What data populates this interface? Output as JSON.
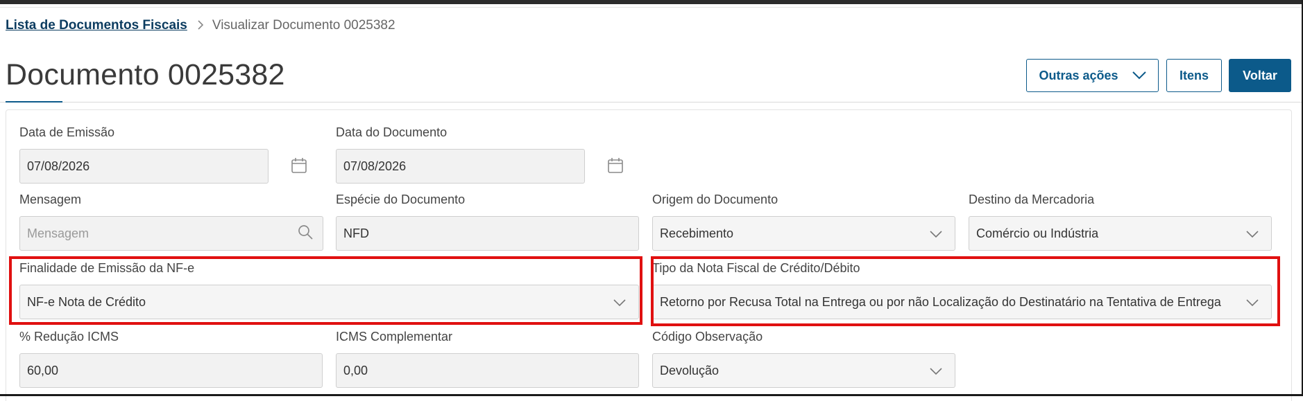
{
  "breadcrumb": {
    "parent": "Lista de Documentos Fiscais",
    "separator": ">",
    "current": "Visualizar Documento 0025382"
  },
  "page_title": "Documento 0025382",
  "actions": {
    "more_actions": "Outras ações",
    "items": "Itens",
    "back": "Voltar"
  },
  "fields": {
    "data_emissao": {
      "label": "Data de Emissão",
      "value": "07/08/2026"
    },
    "data_documento": {
      "label": "Data do Documento",
      "value": "07/08/2026"
    },
    "mensagem": {
      "label": "Mensagem",
      "placeholder": "Mensagem"
    },
    "especie": {
      "label": "Espécie do Documento",
      "value": "NFD"
    },
    "origem": {
      "label": "Origem do Documento",
      "value": "Recebimento"
    },
    "destino": {
      "label": "Destino da Mercadoria",
      "value": "Comércio ou Indústria"
    },
    "finalidade": {
      "label": "Finalidade de Emissão da NF-e",
      "value": "NF-e Nota de Crédito"
    },
    "tipo_nota": {
      "label": "Tipo da Nota Fiscal de Crédito/Débito",
      "value": "Retorno por Recusa Total na Entrega ou por não Localização do Destinatário na Tentativa de Entrega"
    },
    "reducao_icms": {
      "label": "% Redução ICMS",
      "value": "60,00"
    },
    "icms_complementar": {
      "label": "ICMS Complementar",
      "value": "0,00"
    },
    "codigo_observacao": {
      "label": "Código Observação",
      "value": "Devolução"
    }
  },
  "colors": {
    "primary": "#0c5a8a",
    "breadcrumb_link": "#0c3c60",
    "highlight": "#e01010"
  },
  "icons": [
    "calendar-icon",
    "search-icon",
    "chevron-down-icon",
    "chevron-right-icon"
  ]
}
